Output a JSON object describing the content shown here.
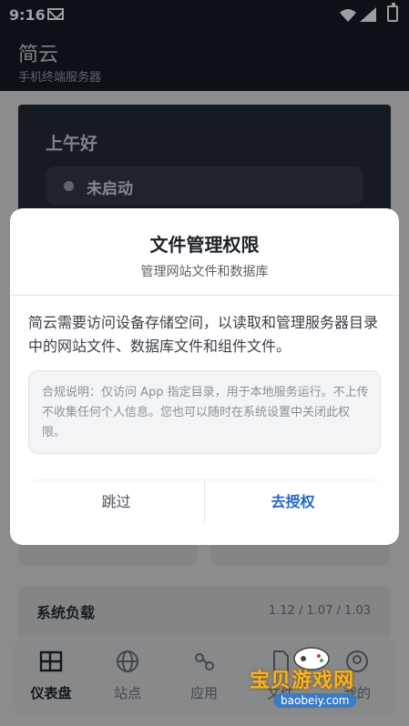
{
  "status": {
    "time": "9:16"
  },
  "app": {
    "title": "简云",
    "subtitle": "手机终端服务器"
  },
  "home": {
    "greeting": "上午好",
    "server_state": "未启动",
    "system_load_label": "系统负载",
    "system_load_value": "1.12 / 1.07 / 1.03"
  },
  "dialog": {
    "title": "文件管理权限",
    "subtitle": "管理网站文件和数据库",
    "body": "简云需要访问设备存储空间，以读取和管理服务器目录中的网站文件、数据库文件和组件文件。",
    "note": "合规说明：仅访问 App 指定目录，用于本地服务运行。不上传不收集任何个人信息。您也可以随时在系统设置中关闭此权限。",
    "skip_label": "跳过",
    "authorize_label": "去授权"
  },
  "nav": {
    "items": [
      {
        "label": "仪表盘",
        "icon": "dashboard-icon",
        "active": true
      },
      {
        "label": "站点",
        "icon": "globe-icon",
        "active": false
      },
      {
        "label": "应用",
        "icon": "apps-icon",
        "active": false
      },
      {
        "label": "文件",
        "icon": "file-icon",
        "active": false
      },
      {
        "label": "我的",
        "icon": "profile-icon",
        "active": false
      }
    ]
  },
  "watermark": {
    "text": "宝贝游戏网",
    "url": "baobeiy.com"
  },
  "colors": {
    "accent": "#2468c8",
    "appbar": "#151b24",
    "dialog_bg": "#ffffff"
  }
}
